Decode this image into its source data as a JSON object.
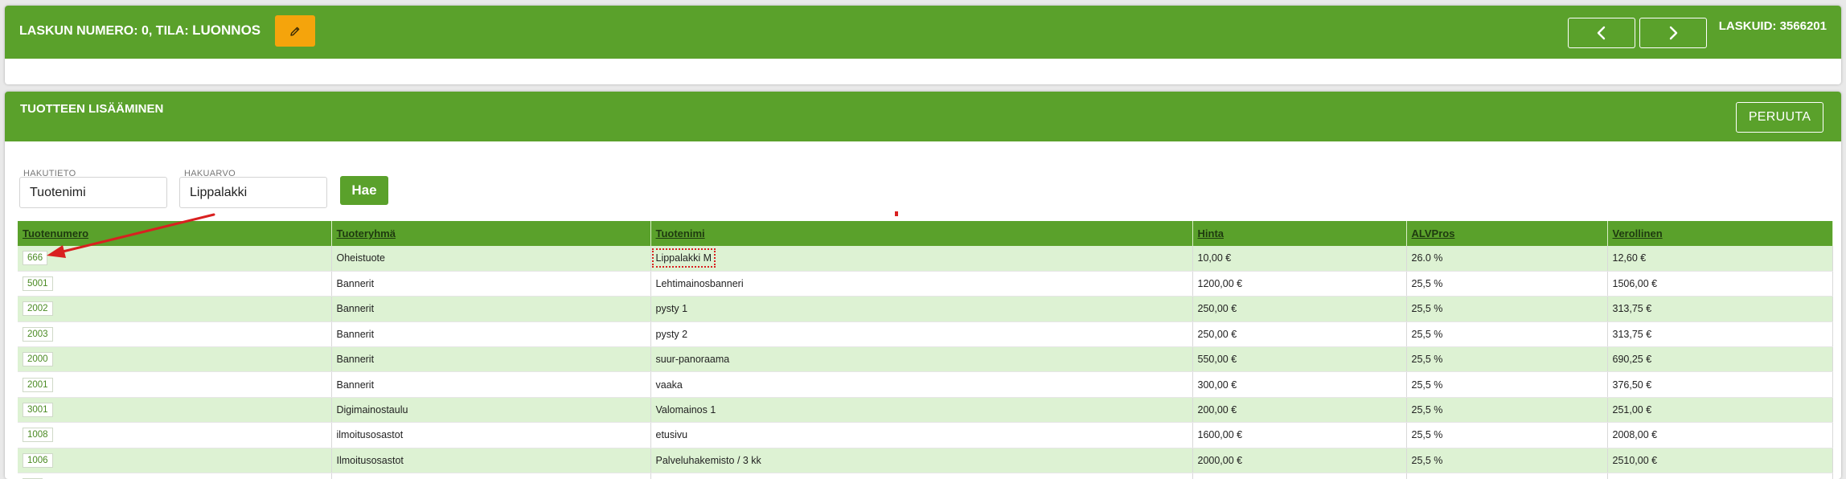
{
  "header": {
    "title_prefix": "LASKUN NUMERO: ",
    "invoice_number": "0",
    "title_middle": ", TILA: ",
    "status": "LUONNOS",
    "laskuid": "LASKUID: 3566201",
    "edit_icon": "pencil-icon",
    "prev_icon": "chevron-left-icon",
    "next_icon": "chevron-right-icon"
  },
  "add_product": {
    "title": "TUOTTEEN LISÄÄMINEN",
    "cancel_label": "PERUUTA",
    "search_field_label": "HAKUTIETO",
    "search_field_value": "Tuotenimi",
    "search_value_label": "HAKUARVO",
    "search_value_value": "Lippalakki",
    "search_button": "Hae"
  },
  "table": {
    "columns": [
      "Tuotenumero",
      "Tuoteryhmä",
      "Tuotenimi",
      "Hinta",
      "ALVPros",
      "Verollinen"
    ],
    "rows": [
      {
        "code": "666",
        "group": "Oheistuote",
        "name": "Lippalakki M",
        "price": "10,00 €",
        "vat": "26.0 %",
        "gross": "12,60 €"
      },
      {
        "code": "5001",
        "group": "Bannerit",
        "name": "Lehtimainosbanneri",
        "price": "1200,00 €",
        "vat": "25,5 %",
        "gross": "1506,00 €"
      },
      {
        "code": "2002",
        "group": "Bannerit",
        "name": "pysty 1",
        "price": "250,00 €",
        "vat": "25,5 %",
        "gross": "313,75 €"
      },
      {
        "code": "2003",
        "group": "Bannerit",
        "name": "pysty 2",
        "price": "250,00 €",
        "vat": "25,5 %",
        "gross": "313,75 €"
      },
      {
        "code": "2000",
        "group": "Bannerit",
        "name": "suur-panoraama",
        "price": "550,00 €",
        "vat": "25,5 %",
        "gross": "690,25 €"
      },
      {
        "code": "2001",
        "group": "Bannerit",
        "name": "vaaka",
        "price": "300,00 €",
        "vat": "25,5 %",
        "gross": "376,50 €"
      },
      {
        "code": "3001",
        "group": "Digimainostaulu",
        "name": "Valomainos 1",
        "price": "200,00 €",
        "vat": "25,5 %",
        "gross": "251,00 €"
      },
      {
        "code": "1008",
        "group": "ilmoitusosastot",
        "name": "etusivu",
        "price": "1600,00 €",
        "vat": "25,5 %",
        "gross": "2008,00 €"
      },
      {
        "code": "1006",
        "group": "Ilmoitusosastot",
        "name": "Palveluhakemisto / 3 kk",
        "price": "2000,00 €",
        "vat": "25,5 %",
        "gross": "2510,00 €"
      }
    ]
  },
  "colors": {
    "brand_green": "#5aa12b",
    "row_green": "#ddf2d3",
    "edit_orange": "#f5a40c",
    "annotation_red": "#d92020"
  }
}
